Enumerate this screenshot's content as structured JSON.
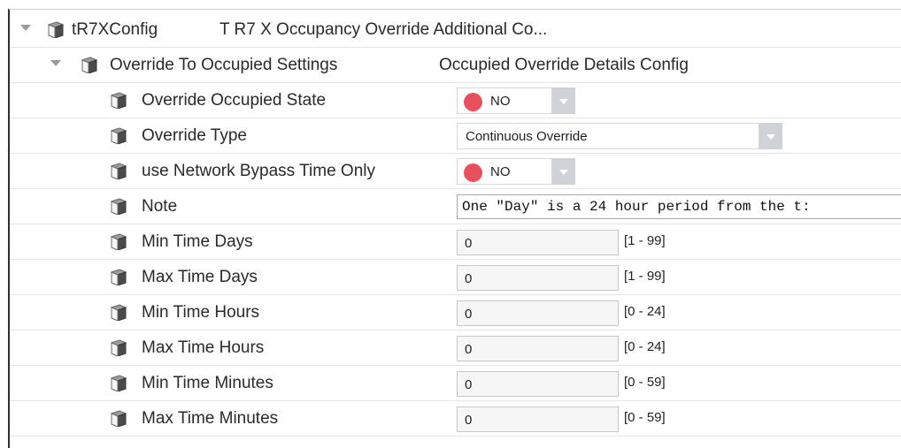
{
  "tree": {
    "root": {
      "name": "tR7XConfig",
      "description": "T R7 X Occupancy Override Additional Co..."
    },
    "group": {
      "name": "Override To Occupied Settings",
      "description": "Occupied Override Details Config"
    }
  },
  "properties": {
    "override_occupied_state": {
      "label": "Override Occupied State",
      "value": "NO",
      "status_color": "#e8505b"
    },
    "override_type": {
      "label": "Override Type",
      "value": "Continuous Override"
    },
    "use_network_bypass": {
      "label": "use Network Bypass Time Only",
      "value": "NO",
      "status_color": "#e8505b"
    },
    "note": {
      "label": "Note",
      "value": "One \"Day\" is a 24 hour period from the t:"
    },
    "min_time_days": {
      "label": "Min Time Days",
      "value": "0",
      "range": "[1 - 99]"
    },
    "max_time_days": {
      "label": "Max Time Days",
      "value": "0",
      "range": "[1 - 99]"
    },
    "min_time_hours": {
      "label": "Min Time Hours",
      "value": "0",
      "range": "[0 - 24]"
    },
    "max_time_hours": {
      "label": "Max Time Hours",
      "value": "0",
      "range": "[0 - 24]"
    },
    "min_time_minutes": {
      "label": "Min Time Minutes",
      "value": "0",
      "range": "[0 - 59]"
    },
    "max_time_minutes": {
      "label": "Max Time Minutes",
      "value": "0",
      "range": "[0 - 59]"
    }
  },
  "icons": {
    "component": "component-cube-icon",
    "expand": "expand-triangle-icon"
  }
}
